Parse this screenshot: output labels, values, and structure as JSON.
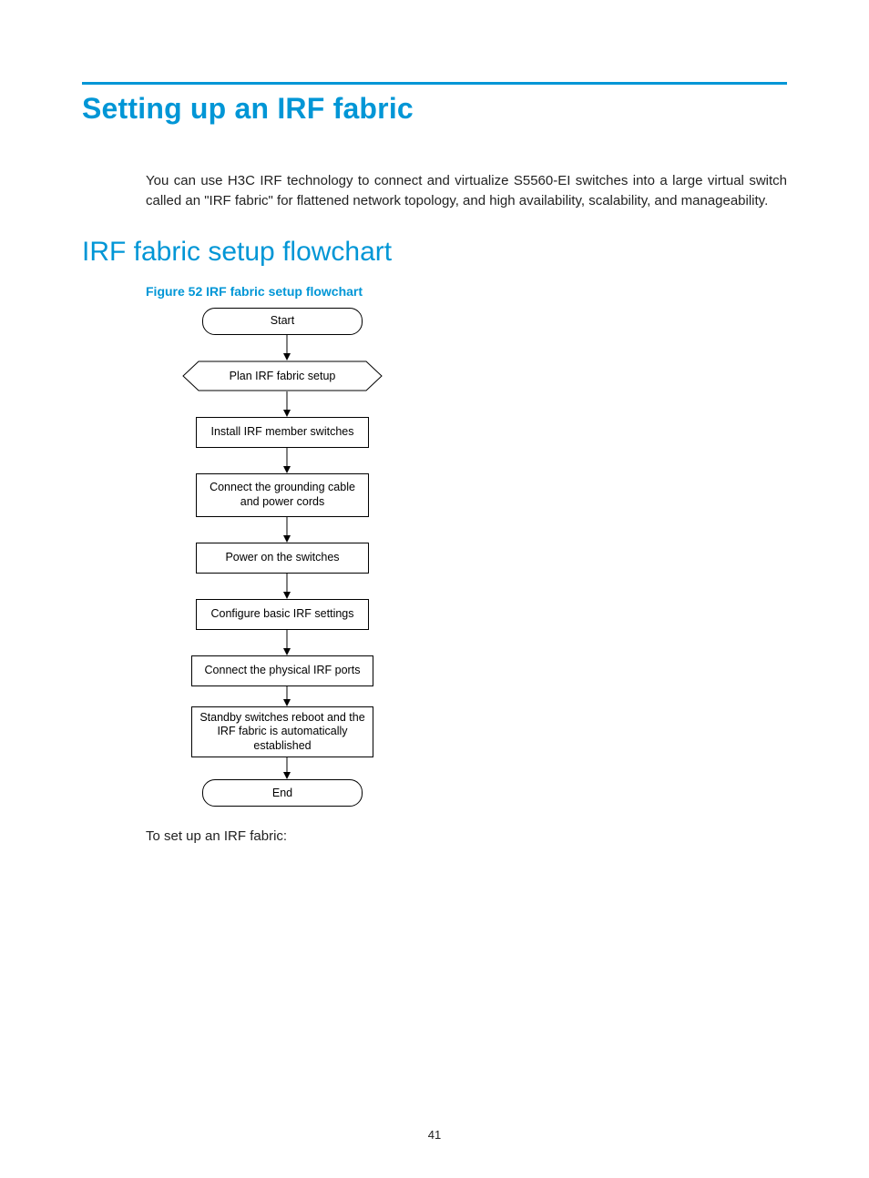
{
  "title": "Setting up an IRF fabric",
  "intro": "You can use H3C IRF technology to connect and virtualize S5560-EI switches into a large virtual switch called an \"IRF fabric\" for flattened network topology, and high availability, scalability, and manageability.",
  "subtitle": "IRF fabric setup flowchart",
  "figure_caption": "Figure 52 IRF fabric setup flowchart",
  "flow": {
    "start": "Start",
    "plan": "Plan IRF fabric setup",
    "install": "Install IRF member switches",
    "ground": "Connect the grounding cable and power cords",
    "power": "Power on the switches",
    "configure": "Configure basic IRF settings",
    "connect_ports": "Connect the physical IRF ports",
    "standby": "Standby switches reboot and the IRF fabric is automatically established",
    "end": "End"
  },
  "leadout": "To set up an IRF fabric:",
  "page_number": "41"
}
